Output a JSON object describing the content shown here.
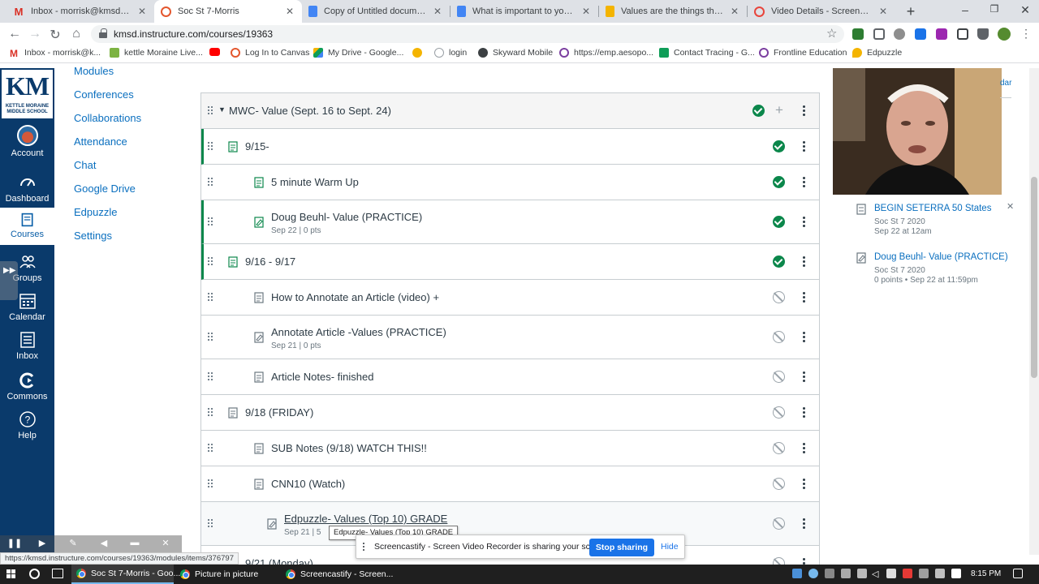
{
  "browser": {
    "tabs": [
      {
        "title": "Inbox - morrisk@kmsd.edu - K",
        "icon": "gmail-icon",
        "color": "#d93025",
        "glyph": "M",
        "active": false
      },
      {
        "title": "Soc St 7-Morris",
        "icon": "canvas-icon",
        "color": "#e4572e",
        "glyph": "",
        "active": true
      },
      {
        "title": "Copy of Untitled document - G",
        "icon": "google-docs-icon",
        "color": "#4285f4",
        "glyph": "",
        "active": false
      },
      {
        "title": "What is important to you - Go",
        "icon": "google-docs-icon",
        "color": "#4285f4",
        "glyph": "",
        "active": false
      },
      {
        "title": "Values are the things that matt",
        "icon": "google-slides-icon",
        "color": "#f4b400",
        "glyph": "",
        "active": false
      },
      {
        "title": "Video Details - Screencastify",
        "icon": "screencastify-icon",
        "color": "#e8453c",
        "glyph": "",
        "active": false
      }
    ],
    "url": "kmsd.instructure.com/courses/19363",
    "bookmarks": [
      {
        "label": "Inbox - morrisk@k...",
        "icon": "gmail-icon",
        "color": "#d93025"
      },
      {
        "label": "kettle Moraine Live...",
        "icon": "classroom-icon",
        "color": "#7cb342"
      },
      {
        "label": "",
        "icon": "youtube-icon",
        "color": "#ff0000"
      },
      {
        "label": "Log In to Canvas",
        "icon": "canvas-icon",
        "color": "#e4572e"
      },
      {
        "label": "My Drive - Google...",
        "icon": "google-drive-icon",
        "color": "#0f9d58"
      },
      {
        "label": "",
        "icon": "sun-icon",
        "color": "#f4b400"
      },
      {
        "label": "login",
        "icon": "eye-icon",
        "color": "#9aa0a6"
      },
      {
        "label": "Skyward Mobile",
        "icon": "skyward-icon",
        "color": "#3c4043"
      },
      {
        "label": "https://emp.aesopo...",
        "icon": "frontline-icon",
        "color": "#7b3fa0"
      },
      {
        "label": "Contact Tracing - G...",
        "icon": "google-sheets-icon",
        "color": "#0f9d58"
      },
      {
        "label": "Frontline Education",
        "icon": "frontline-icon",
        "color": "#7b3fa0"
      },
      {
        "label": "Edpuzzle",
        "icon": "edpuzzle-icon",
        "color": "#f4b400"
      }
    ]
  },
  "logo": {
    "letters": "KM",
    "school": "KETTLE MORAINE MIDDLE SCHOOL"
  },
  "global_nav": [
    {
      "label": "Account",
      "icon": "account-avatar-icon",
      "active": false
    },
    {
      "label": "Dashboard",
      "icon": "dashboard-icon",
      "active": false
    },
    {
      "label": "Courses",
      "icon": "courses-icon",
      "active": true
    },
    {
      "label": "Groups",
      "icon": "groups-icon",
      "active": false
    },
    {
      "label": "Calendar",
      "icon": "calendar-icon",
      "active": false
    },
    {
      "label": "Inbox",
      "icon": "inbox-icon",
      "active": false
    },
    {
      "label": "Commons",
      "icon": "commons-icon",
      "active": false
    },
    {
      "label": "Help",
      "icon": "help-icon",
      "active": false
    }
  ],
  "course_nav": [
    "Modules",
    "Conferences",
    "Collaborations",
    "Attendance",
    "Chat",
    "Google Drive",
    "Edpuzzle",
    "Settings"
  ],
  "module": {
    "title": "MWC- Value (Sept. 16 to Sept. 24)",
    "items": [
      {
        "title": "9/15-",
        "meta": "",
        "type": "page",
        "indent": 0,
        "status": "published",
        "completed": true
      },
      {
        "title": "5 minute Warm Up",
        "meta": "",
        "type": "page",
        "indent": 1,
        "status": "published",
        "completed": false
      },
      {
        "title": "Doug Beuhl- Value (PRACTICE)",
        "meta": "Sep 22  |  0 pts",
        "type": "assignment",
        "indent": 1,
        "status": "published",
        "completed": true
      },
      {
        "title": "9/16 - 9/17",
        "meta": "",
        "type": "page",
        "indent": 0,
        "status": "published",
        "completed": true
      },
      {
        "title": "How to Annotate an Article (video) +",
        "meta": "",
        "type": "page",
        "indent": 1,
        "status": "unpublished",
        "completed": false
      },
      {
        "title": "Annotate Article -Values (PRACTICE)",
        "meta": "Sep 21  |  0 pts",
        "type": "assignment",
        "indent": 1,
        "status": "unpublished",
        "completed": false
      },
      {
        "title": "Article Notes- finished",
        "meta": "",
        "type": "page",
        "indent": 1,
        "status": "unpublished",
        "completed": false
      },
      {
        "title": "9/18 (FRIDAY)",
        "meta": "",
        "type": "page",
        "indent": 0,
        "status": "unpublished",
        "completed": false
      },
      {
        "title": "SUB Notes (9/18) WATCH THIS!!",
        "meta": "",
        "type": "page",
        "indent": 1,
        "status": "unpublished",
        "completed": false
      },
      {
        "title": "CNN10 (Watch)",
        "meta": "",
        "type": "page",
        "indent": 1,
        "status": "unpublished",
        "completed": false
      },
      {
        "title": "Edpuzzle- Values (Top 10) GRADE",
        "meta": "Sep 21  |  5",
        "type": "assignment",
        "indent": 2,
        "status": "unpublished",
        "completed": false,
        "hovered": true
      },
      {
        "title": "9/21 (Monday)",
        "meta": "",
        "type": "page",
        "indent": 0,
        "status": "unpublished",
        "completed": false
      }
    ]
  },
  "todo_header": "dar",
  "todo": [
    {
      "title": "BEGIN SETERRA 50 States",
      "course": "Soc St 7 2020",
      "when": "Sep 22 at 12am",
      "icon": "quiz-icon"
    },
    {
      "title": "Doug Beuhl- Value (PRACTICE)",
      "course": "Soc St 7 2020",
      "when": "0 points • Sep 22 at 11:59pm",
      "icon": "assignment-icon"
    }
  ],
  "tooltip": "Edpuzzle- Values (Top 10) GRADE",
  "sharebar": {
    "text": "Screencastify - Screen Video Recorder is sharing your screen.",
    "stop": "Stop sharing",
    "hide": "Hide"
  },
  "status_url": "https://kmsd.instructure.com/courses/19363/modules/items/376797",
  "taskbar": {
    "apps": [
      {
        "label": "Soc St 7-Morris - Goo...",
        "active": true
      },
      {
        "label": "Picture in picture",
        "active": false
      },
      {
        "label": "Screencastify - Screen...",
        "active": false
      }
    ],
    "clock": "8:15 PM"
  }
}
